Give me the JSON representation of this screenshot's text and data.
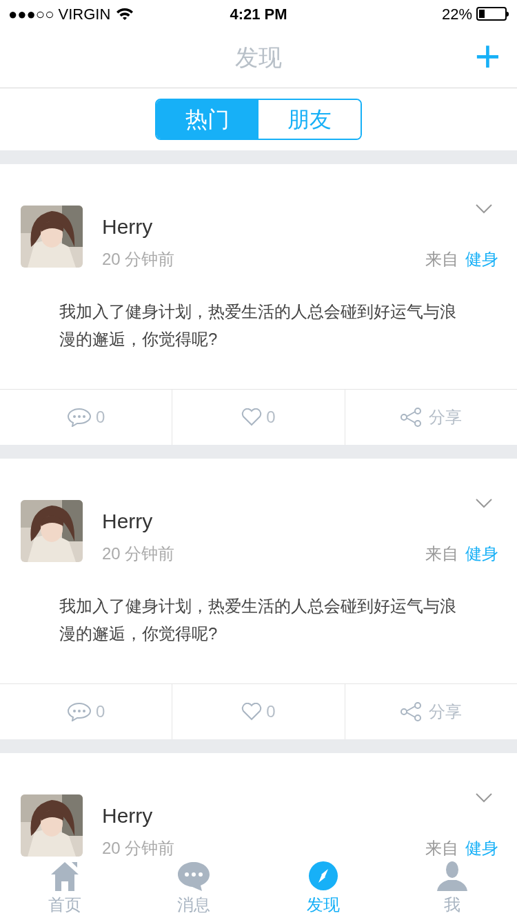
{
  "status_bar": {
    "carrier": "●●●○○ VIRGIN",
    "time": "4:21 PM",
    "battery": "22%"
  },
  "nav": {
    "title": "发现",
    "action": "+"
  },
  "segments": [
    {
      "label": "热门",
      "selected": true
    },
    {
      "label": "朋友",
      "selected": false
    }
  ],
  "posts": [
    {
      "name": "Herry",
      "time": "20 分钟前",
      "source_prefix": "来自",
      "source": "健身",
      "text": "我加入了健身计划，热爱生活的人总会碰到好运气与浪漫的邂逅，你觉得呢?",
      "comments": "0",
      "likes": "0",
      "share": "分享"
    },
    {
      "name": "Herry",
      "time": "20 分钟前",
      "source_prefix": "来自",
      "source": "健身",
      "text": "我加入了健身计划，热爱生活的人总会碰到好运气与浪漫的邂逅，你觉得呢?",
      "comments": "0",
      "likes": "0",
      "share": "分享"
    },
    {
      "name": "Herry",
      "time": "20 分钟前",
      "source_prefix": "来自",
      "source": "健身"
    }
  ],
  "tab_bar": [
    {
      "kind": "home",
      "label": "首页",
      "selected": false
    },
    {
      "kind": "chat",
      "label": "消息",
      "selected": false
    },
    {
      "kind": "compass",
      "label": "发现",
      "selected": true
    },
    {
      "kind": "person",
      "label": "我",
      "selected": false
    }
  ]
}
